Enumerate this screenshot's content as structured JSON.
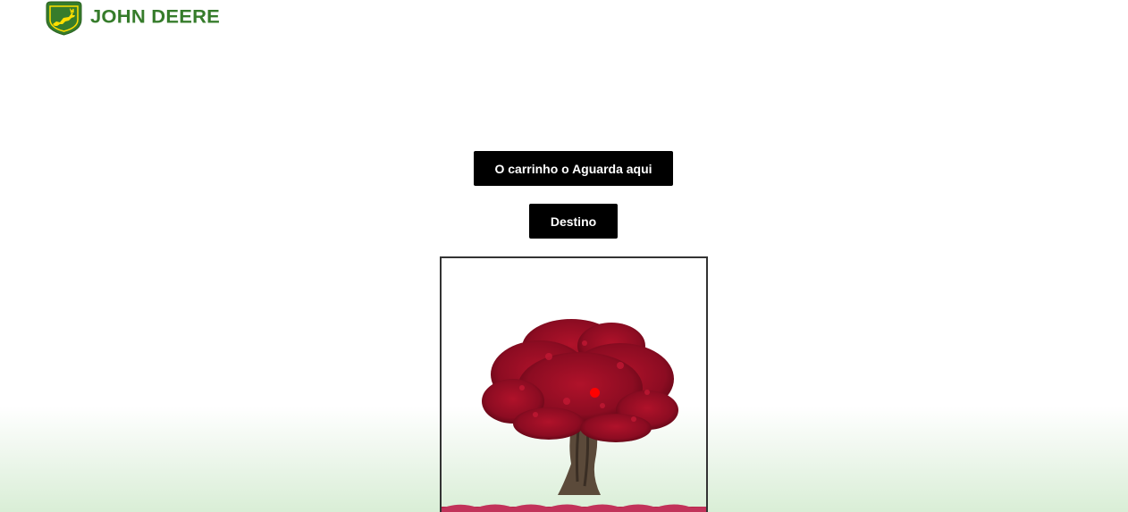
{
  "brand": {
    "name": "JOHN DEERE",
    "logo_icon": "john-deere-leaping-deer-logo",
    "color_green": "#367c2b",
    "color_yellow": "#ffde00"
  },
  "actions": {
    "waiting_label": "O carrinho o Aguarda aqui",
    "destination_label": "Destino"
  },
  "map": {
    "image": "red-bonsai-tree",
    "marker_color": "#ff0000"
  },
  "colors": {
    "button_bg": "#000000",
    "button_text": "#ffffff",
    "footer_gradient": "#d9eed6"
  }
}
